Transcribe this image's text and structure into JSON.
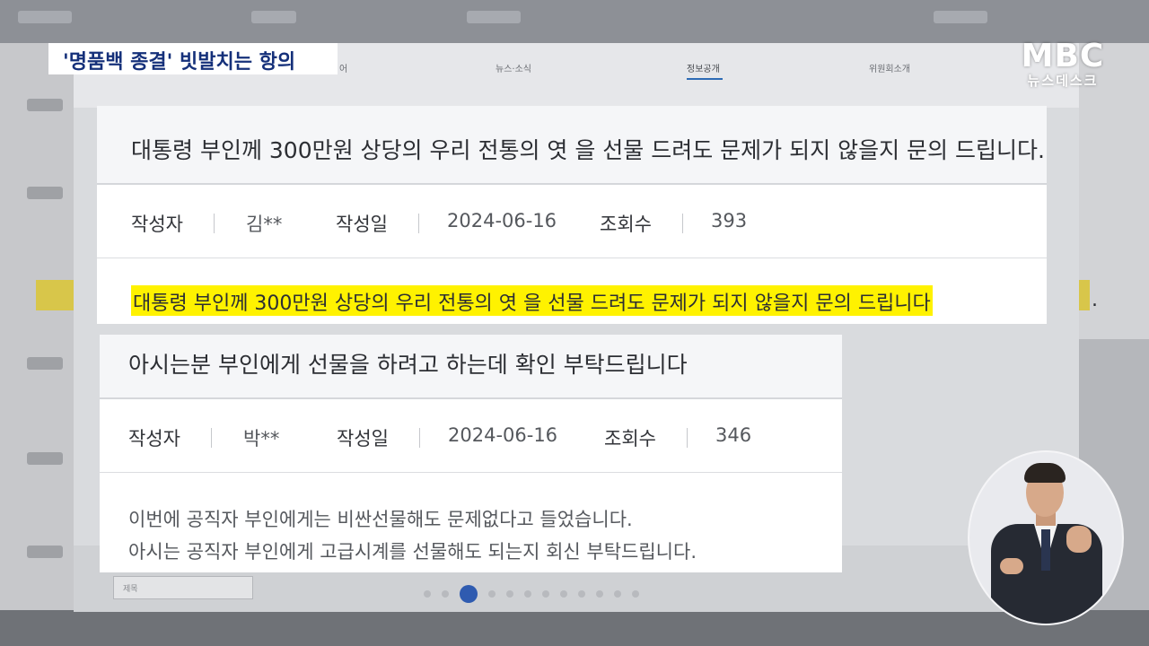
{
  "caption": "'명품백 종결' 빗발치는 항의",
  "broadcaster": {
    "logo": "MBC",
    "program": "뉴스데스크"
  },
  "background_nav": {
    "items": [
      "뉴스·소식",
      "정보공개",
      "위원회소개"
    ],
    "partial_item": "어",
    "active": "정보공개"
  },
  "background": {
    "select_label": "제목"
  },
  "posts": [
    {
      "title": "대통령 부인께 300만원 상당의 우리 전통의 엿 을 선물 드려도 문제가 되지 않을지 문의 드립니다.",
      "author_label": "작성자",
      "author": "김**",
      "date_label": "작성일",
      "date": "2024-06-16",
      "views_label": "조회수",
      "views": "393",
      "body_highlight": "대통령 부인께 300만원 상당의 우리 전통의 엿 을 선물 드려도 문제가 되지 않을지 문의 드립니다",
      "body_tail": "."
    },
    {
      "title": "아시는분 부인에게 선물을 하려고 하는데 확인 부탁드립니다",
      "author_label": "작성자",
      "author": "박**",
      "date_label": "작성일",
      "date": "2024-06-16",
      "views_label": "조회수",
      "views": "346",
      "body_lines": [
        "이번에 공직자 부인에게는 비싼선물해도 문제없다고 들었습니다.",
        "아시는 공직자 부인에게 고급시계를 선물해도 되는지 회신 부탁드립니다."
      ]
    }
  ],
  "colors": {
    "caption_text": "#15307a",
    "highlight": "#fff200",
    "nav_active": "#2d6bb5",
    "pager_current": "#2f5bb0"
  }
}
